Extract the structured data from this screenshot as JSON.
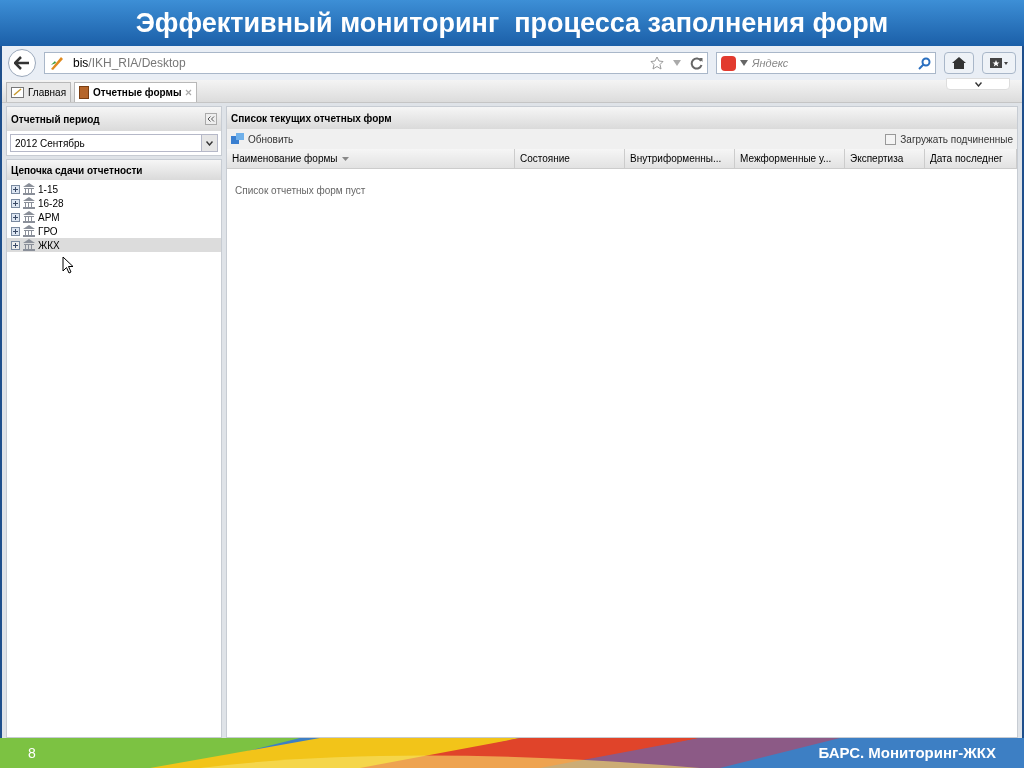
{
  "slide": {
    "title": "Эффективный мониторинг  процесса заполнения форм",
    "page_number": "8",
    "footer": "БАРС. Мониторинг-ЖКХ"
  },
  "browser": {
    "url_prefix": "bis",
    "url_path": "/IKH_RIA/Desktop",
    "search_placeholder": "Яндекс"
  },
  "tabs": [
    {
      "label": "Главная",
      "selected": false,
      "closable": false
    },
    {
      "label": "Отчетные формы",
      "selected": true,
      "closable": true
    }
  ],
  "left_panel": {
    "period_title": "Отчетный период",
    "period_value": "2012 Сентябрь",
    "chain_title": "Цепочка сдачи отчетности",
    "tree": [
      {
        "label": "1-15",
        "expanded": false,
        "selected": false
      },
      {
        "label": "16-28",
        "expanded": false,
        "selected": false
      },
      {
        "label": "АРМ",
        "expanded": false,
        "selected": false
      },
      {
        "label": "ГРО",
        "expanded": false,
        "selected": false
      },
      {
        "label": "ЖКХ",
        "expanded": false,
        "selected": true
      }
    ]
  },
  "right_panel": {
    "title": "Список текущих отчетных форм",
    "refresh": "Обновить",
    "load_sub": {
      "label": "Загружать подчиненные",
      "checked": false
    },
    "columns": [
      {
        "label": "Наименование формы",
        "sorted": true
      },
      {
        "label": "Состояние",
        "sorted": false
      },
      {
        "label": "Внутриформенны...",
        "sorted": false
      },
      {
        "label": "Межформенные у...",
        "sorted": false
      },
      {
        "label": "Экспертиза",
        "sorted": false
      },
      {
        "label": "Дата последнег",
        "sorted": false
      }
    ],
    "empty_text": "Список отчетных форм пуст"
  }
}
